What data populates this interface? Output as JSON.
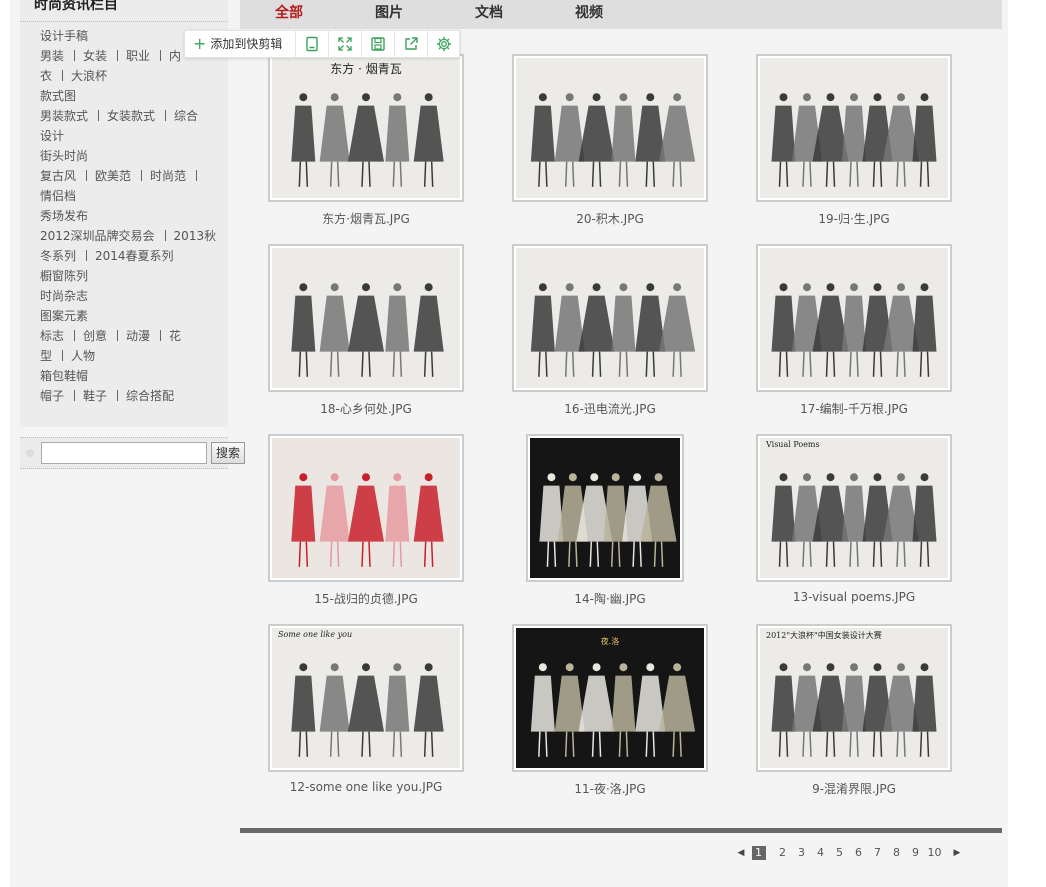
{
  "sidebar": {
    "title": "时尚资讯栏目",
    "rows": [
      {
        "links": [
          "设计手稿"
        ],
        "indent": false
      },
      {
        "links": [
          "男装",
          "女装",
          "职业",
          "内"
        ],
        "indent": false
      },
      {
        "links": [
          "衣",
          "大浪杯"
        ],
        "indent": false
      },
      {
        "links": [
          "款式图"
        ],
        "indent": false
      },
      {
        "links": [
          "男装款式",
          "女装款式",
          "综合"
        ],
        "indent": false
      },
      {
        "links": [
          "设计"
        ],
        "indent": false
      },
      {
        "links": [
          "街头时尚"
        ],
        "indent": false
      },
      {
        "links": [
          "复古风",
          "欧美范",
          "时尚范",
          ""
        ],
        "indent": false
      },
      {
        "links": [
          "情侣档"
        ],
        "indent": false
      },
      {
        "links": [
          "秀场发布"
        ],
        "indent": false
      },
      {
        "links": [
          "2012深圳品牌交易会",
          "2013秋"
        ],
        "indent": false
      },
      {
        "links": [
          "冬系列",
          "2014春夏系列"
        ],
        "indent": false
      },
      {
        "links": [
          "橱窗陈列"
        ],
        "indent": false
      },
      {
        "links": [
          "时尚杂志"
        ],
        "indent": false
      },
      {
        "links": [
          "图案元素"
        ],
        "indent": false
      },
      {
        "links": [
          "标志",
          "创意",
          "动漫",
          "花"
        ],
        "indent": false
      },
      {
        "links": [
          "型",
          "人物"
        ],
        "indent": false
      },
      {
        "links": [
          "箱包鞋帽"
        ],
        "indent": false
      },
      {
        "links": [
          "帽子",
          "鞋子",
          "综合搭配"
        ],
        "indent": false
      }
    ]
  },
  "search": {
    "value": "",
    "button_label": "搜索"
  },
  "tabs": [
    {
      "label": "全部",
      "active": true
    },
    {
      "label": "图片",
      "active": false
    },
    {
      "label": "文档",
      "active": false
    },
    {
      "label": "视频",
      "active": false
    }
  ],
  "clip_toolbar": {
    "add_label": "添加到快剪辑",
    "icons": [
      "bookmark-icon",
      "fullscreen-icon",
      "save-icon",
      "share-icon",
      "settings-icon"
    ],
    "accent": "#3aa35c"
  },
  "gallery": [
    {
      "caption": "东方·烟青瓦.JPG",
      "art": "light"
    },
    {
      "caption": "20-积木.JPG",
      "art": "light"
    },
    {
      "caption": "19-归·生.JPG",
      "art": "light"
    },
    {
      "caption": "18-心乡何处.JPG",
      "art": "light"
    },
    {
      "caption": "16-迅电流光.JPG",
      "art": "light"
    },
    {
      "caption": "17-编制-千万根.JPG",
      "art": "light"
    },
    {
      "caption": "15-战归的贞德.JPG",
      "art": "red"
    },
    {
      "caption": "14-陶·幽.JPG",
      "art": "dark"
    },
    {
      "caption": "13-visual poems.JPG",
      "art": "light"
    },
    {
      "caption": "12-some one like you.JPG",
      "art": "light"
    },
    {
      "caption": "11-夜·洛.JPG",
      "art": "dark"
    },
    {
      "caption": "9-混淆界限.JPG",
      "art": "light"
    }
  ],
  "thumb_texts": {
    "t0": "东方 · 烟青瓦",
    "t9": "Some one like you",
    "t10": "夜.洛",
    "t11": "2012\"大浪杯\"中国女装设计大赛",
    "t8": "Visual Poems"
  },
  "pager": {
    "prev": "◀",
    "next": "▶",
    "current": "1",
    "pages": [
      "2",
      "3",
      "4",
      "5",
      "6",
      "7",
      "8",
      "9",
      "10"
    ]
  }
}
